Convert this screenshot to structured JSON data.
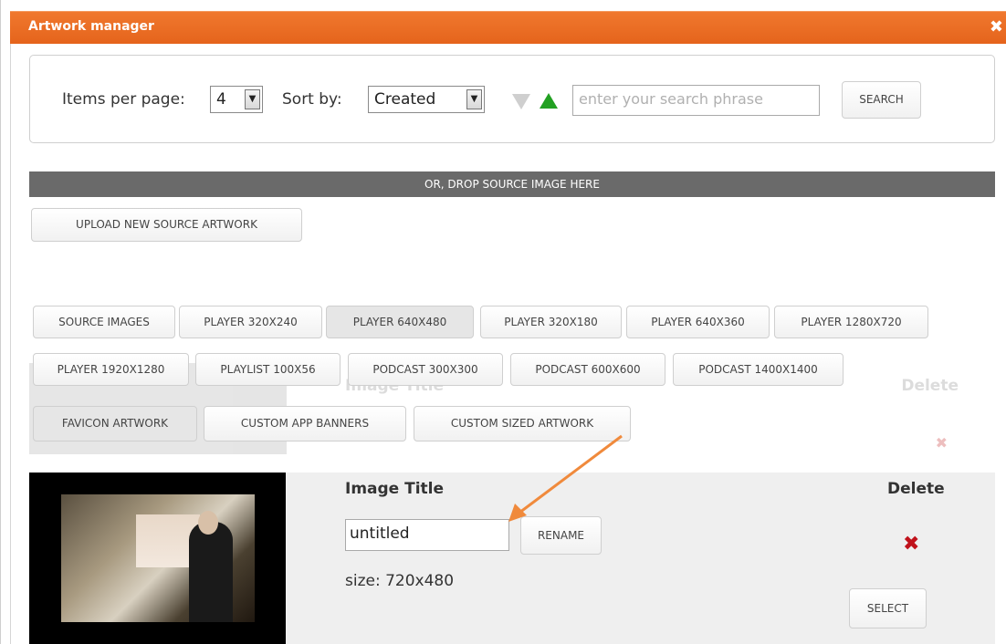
{
  "window": {
    "title": "Artwork manager",
    "close_glyph": "✖"
  },
  "toolbar": {
    "items_per_page_label": "Items per page:",
    "items_per_page_value": "4",
    "sort_by_label": "Sort by:",
    "sort_by_value": "Created",
    "sort_desc_icon": "triangle-down-icon",
    "sort_asc_icon": "triangle-up-icon",
    "search_placeholder": "enter your search phrase",
    "search_label": "SEARCH"
  },
  "drop_bar": {
    "text": "OR, DROP SOURCE IMAGE HERE"
  },
  "upload_label": "UPLOAD NEW SOURCE ARTWORK",
  "formats": [
    {
      "label": "SOURCE IMAGES"
    },
    {
      "label": "PLAYER 320X240"
    },
    {
      "label": "PLAYER 640X480"
    },
    {
      "label": "PLAYER 320X180"
    },
    {
      "label": "PLAYER 640X360"
    },
    {
      "label": "PLAYER 1280X720"
    },
    {
      "label": "PLAYER 1920X1280"
    },
    {
      "label": "PLAYLIST 100X56"
    },
    {
      "label": "PODCAST 300X300"
    },
    {
      "label": "PODCAST 600X600"
    },
    {
      "label": "PODCAST 1400X1400"
    },
    {
      "label": "FAVICON ARTWORK"
    },
    {
      "label": "CUSTOM APP BANNERS"
    },
    {
      "label": "CUSTOM SIZED ARTWORK"
    }
  ],
  "ghost_row": {
    "title_label": "Image Title",
    "delete_label": "Delete",
    "delete_glyph": "✖"
  },
  "item": {
    "title_label": "Image Title",
    "delete_label": "Delete",
    "title_value": "untitled",
    "rename_label": "RENAME",
    "size_text": "size: 720x480",
    "delete_glyph": "✖",
    "select_label": "SELECT"
  },
  "colors": {
    "titlebar": "#e86a22",
    "drop_bar": "#6a6a6a",
    "sort_active": "#22a022",
    "delete": "#c0121b",
    "annotation_arrow": "#f08a3c"
  }
}
